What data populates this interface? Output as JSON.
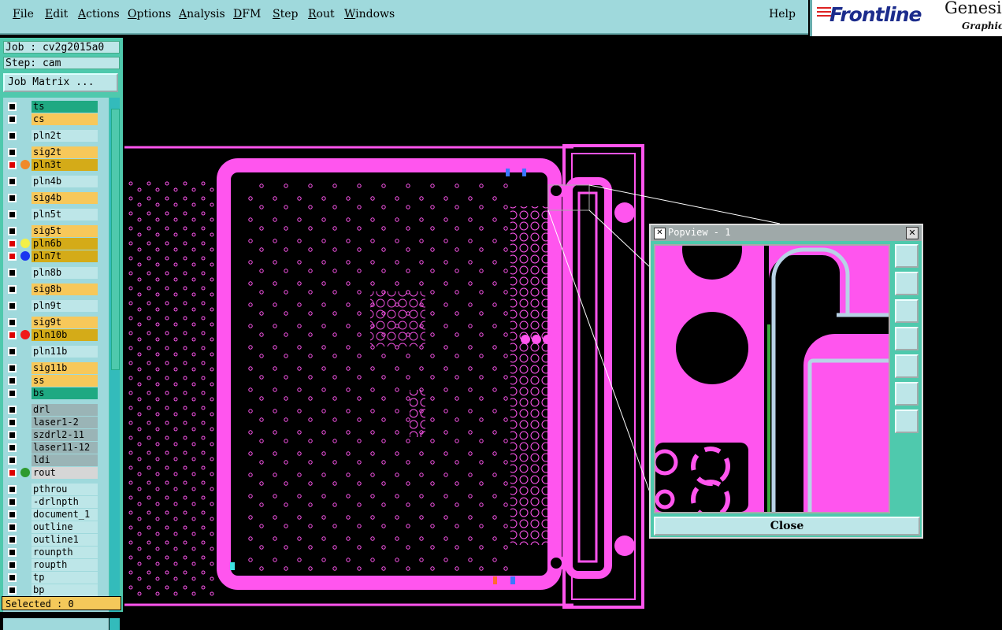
{
  "menu": {
    "items": [
      "File",
      "Edit",
      "Actions",
      "Options",
      "Analysis",
      "DFM",
      "Step",
      "Rout",
      "Windows"
    ],
    "help": "Help"
  },
  "logo": {
    "brand": "Frontline",
    "product": "Genesis",
    "sub": "Graphic"
  },
  "panel": {
    "job": "Job : cv2g2015a0",
    "step": "Step: cam",
    "job_matrix": "Job Matrix ...",
    "selected": "Selected : 0"
  },
  "layers": [
    {
      "name": "ts",
      "color": "#1fa982",
      "dot": ""
    },
    {
      "name": "cs",
      "color": "#f7c85a",
      "dot": ""
    },
    {
      "name": "pln2t",
      "color": "#bde6e8",
      "dot": ""
    },
    {
      "name": "sig2t",
      "color": "#f7c85a",
      "dot": ""
    },
    {
      "name": "pln3t",
      "color": "#d4ab18",
      "dot": "#f08a2a"
    },
    {
      "name": "pln4b",
      "color": "#bde6e8",
      "dot": ""
    },
    {
      "name": "sig4b",
      "color": "#f7c85a",
      "dot": ""
    },
    {
      "name": "pln5t",
      "color": "#bde6e8",
      "dot": ""
    },
    {
      "name": "sig5t",
      "color": "#f7c85a",
      "dot": ""
    },
    {
      "name": "pln6b",
      "color": "#d4ab18",
      "dot": "#f3f048"
    },
    {
      "name": "pln7t",
      "color": "#d4ab18",
      "dot": "#1a36f0"
    },
    {
      "name": "pln8b",
      "color": "#bde6e8",
      "dot": ""
    },
    {
      "name": "sig8b",
      "color": "#f7c85a",
      "dot": ""
    },
    {
      "name": "pln9t",
      "color": "#bde6e8",
      "dot": ""
    },
    {
      "name": "sig9t",
      "color": "#f7c85a",
      "dot": ""
    },
    {
      "name": "pln10b",
      "color": "#d4ab18",
      "dot": "#f01a1a"
    },
    {
      "name": "pln11b",
      "color": "#bde6e8",
      "dot": ""
    },
    {
      "name": "sig11b",
      "color": "#f7c85a",
      "dot": ""
    },
    {
      "name": "ss",
      "color": "#f7c85a",
      "dot": ""
    },
    {
      "name": "bs",
      "color": "#1fa982",
      "dot": ""
    },
    {
      "name": "drl",
      "color": "#9ab4b6",
      "dot": ""
    },
    {
      "name": "laser1-2",
      "color": "#9ab4b6",
      "dot": ""
    },
    {
      "name": "szdrl2-11",
      "color": "#9ab4b6",
      "dot": ""
    },
    {
      "name": "laser11-12",
      "color": "#9ab4b6",
      "dot": ""
    },
    {
      "name": "ldi",
      "color": "#9ab4b6",
      "dot": ""
    },
    {
      "name": "rout",
      "color": "#d6d6d6",
      "dot": "#2e9a2e"
    },
    {
      "name": "pthrou",
      "color": "#bde6e8",
      "dot": ""
    },
    {
      "name": "-drlnpth",
      "color": "#bde6e8",
      "dot": ""
    },
    {
      "name": "document_1",
      "color": "#bde6e8",
      "dot": ""
    },
    {
      "name": "outline",
      "color": "#bde6e8",
      "dot": ""
    },
    {
      "name": "outline1",
      "color": "#bde6e8",
      "dot": ""
    },
    {
      "name": "rounpth",
      "color": "#bde6e8",
      "dot": ""
    },
    {
      "name": "roupth",
      "color": "#bde6e8",
      "dot": ""
    },
    {
      "name": "tp",
      "color": "#bde6e8",
      "dot": ""
    },
    {
      "name": "bp",
      "color": "#bde6e8",
      "dot": ""
    }
  ],
  "popview": {
    "title": "Popview - 1",
    "close_label": "Close"
  },
  "colors": {
    "board": "#ff55ee",
    "canvas": "#000000",
    "panel": "#4fc9ad"
  }
}
